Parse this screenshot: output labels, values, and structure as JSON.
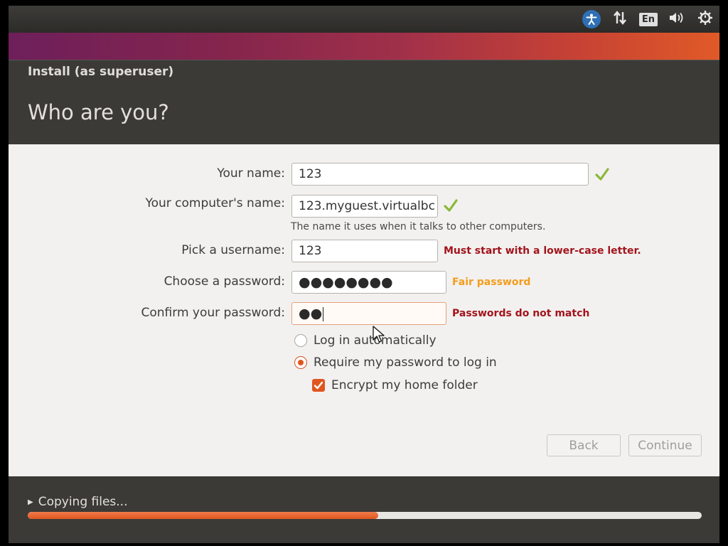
{
  "top_panel": {
    "indicators": [
      {
        "icon": "accessibility-icon"
      },
      {
        "icon": "network-arrows-icon"
      },
      {
        "icon": "keyboard-layout-icon",
        "label": "En"
      },
      {
        "icon": "volume-icon"
      },
      {
        "icon": "power-gear-icon"
      }
    ]
  },
  "window": {
    "title": "Install (as superuser)",
    "heading": "Who are you?"
  },
  "form": {
    "your_name": {
      "label": "Your name:",
      "value": "123",
      "valid": true
    },
    "computer_name": {
      "label": "Your computer's name:",
      "value": "123.myguest.virtualbc",
      "valid": true,
      "hint": "The name it uses when it talks to other computers."
    },
    "username": {
      "label": "Pick a username:",
      "value": "123",
      "message": "Must start with a lower-case letter."
    },
    "password": {
      "label": "Choose a password:",
      "value": "●●●●●●●●",
      "strength": "Fair password"
    },
    "confirm_password": {
      "label": "Confirm your password:",
      "value": "●●",
      "message": "Passwords do not match"
    }
  },
  "login_options": {
    "auto_login": {
      "label": "Log in automatically",
      "selected": false
    },
    "require_password": {
      "label": "Require my password to log in",
      "selected": true
    },
    "encrypt_home": {
      "label": "Encrypt my home folder",
      "checked": true
    }
  },
  "buttons": {
    "back": "Back",
    "continue": "Continue"
  },
  "footer": {
    "status": "Copying files...",
    "progress": 0.52
  },
  "colors": {
    "accent": "#e0561f",
    "error": "#a3141c",
    "warning": "#f39d1c",
    "valid": "#8ab836",
    "panel": "#3b3a37"
  }
}
